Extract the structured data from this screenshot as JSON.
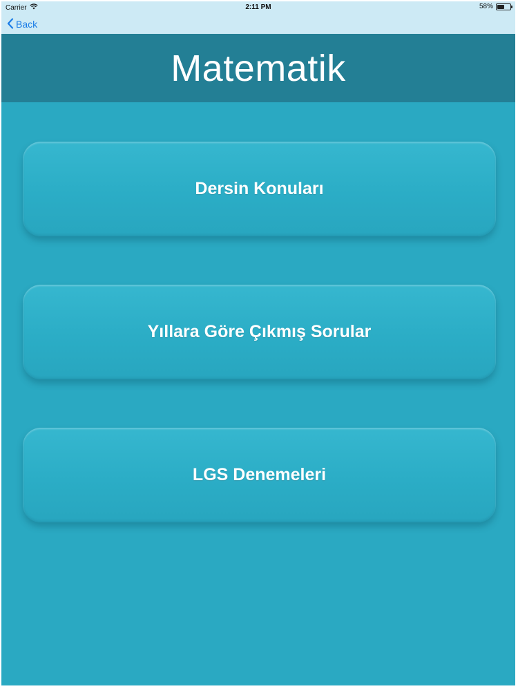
{
  "status_bar": {
    "carrier": "Carrier",
    "time": "2:11 PM",
    "battery_percent": "58%",
    "battery_level": 0.58
  },
  "nav": {
    "back_label": "Back"
  },
  "header": {
    "title": "Matematik"
  },
  "menu": {
    "items": [
      {
        "label": "Dersin Konuları"
      },
      {
        "label": "Yıllara Göre Çıkmış Sorular"
      },
      {
        "label": "LGS Denemeleri"
      }
    ]
  },
  "colors": {
    "background": "#2aa9c2",
    "header": "#237f95",
    "nav_bar": "#cdeaf5",
    "back_link": "#1a7ce6"
  },
  "icons": {
    "wifi": "wifi-icon",
    "battery": "battery-icon",
    "back": "chevron-left-icon"
  }
}
